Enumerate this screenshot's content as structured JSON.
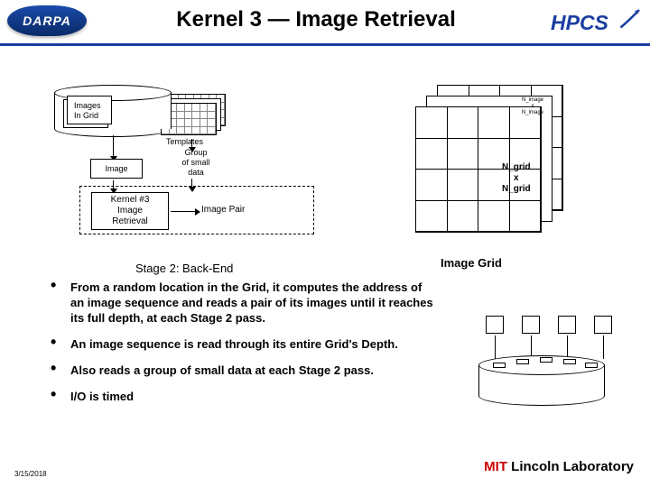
{
  "header": {
    "logo_left": "DARPA",
    "title": "Kernel 3 — Image Retrieval",
    "logo_right": "HPCS"
  },
  "diagram": {
    "cylinder_label": "Images\nIn Grid",
    "templates_label": "Templates",
    "image_box": "Image",
    "small_data": "Group\nof small\ndata",
    "kernel_box": "Kernel #3\nImage\nRetrieval",
    "image_pair": "Image Pair",
    "grid_small_label": "N_image\nx\nN_image",
    "grid_big_label": "N_grid\nx\nN_grid",
    "grid_caption": "Image Grid"
  },
  "stage_label": "Stage 2:  Back-End",
  "bullets": [
    "From a random location in the Grid, it computes the address of an image sequence and reads a pair of its images until it reaches its full depth, at each Stage 2 pass.",
    "An image sequence is read through its entire Grid's Depth.",
    "Also reads a group of small data at each Stage 2 pass.",
    "I/O is timed"
  ],
  "footer": {
    "date": "3/15/2018",
    "lab_mit": "MIT",
    "lab_rest": " Lincoln Laboratory"
  }
}
